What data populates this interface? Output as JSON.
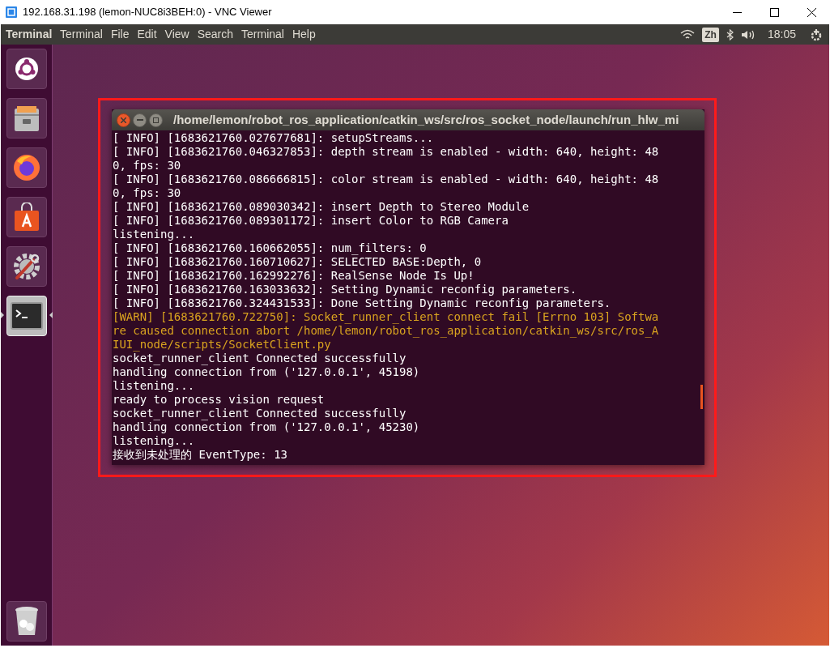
{
  "vnc_window": {
    "title": "192.168.31.198 (lemon-NUC8i3BEH:0) - VNC Viewer"
  },
  "top_panel": {
    "app_name": "Terminal",
    "menus": [
      "Terminal",
      "File",
      "Edit",
      "View",
      "Search",
      "Terminal",
      "Help"
    ],
    "keyboard_layout": "Zh",
    "clock": "18:05"
  },
  "launcher": {
    "items": [
      {
        "kind": "dash",
        "selected": false
      },
      {
        "kind": "files",
        "selected": false
      },
      {
        "kind": "firefox",
        "selected": false
      },
      {
        "kind": "software",
        "selected": false
      },
      {
        "kind": "settings",
        "selected": false
      },
      {
        "kind": "terminal",
        "selected": true
      }
    ],
    "trash": {
      "kind": "trash"
    }
  },
  "terminal": {
    "title": "/home/lemon/robot_ros_application/catkin_ws/src/ros_socket_node/launch/run_hlw_mi",
    "lines": [
      {
        "kind": "info",
        "text": "[ INFO] [1683621760.027677681]: setupStreams..."
      },
      {
        "kind": "info",
        "text": "[ INFO] [1683621760.046327853]: depth stream is enabled - width: 640, height: 48"
      },
      {
        "kind": "info",
        "text": "0, fps: 30"
      },
      {
        "kind": "info",
        "text": "[ INFO] [1683621760.086666815]: color stream is enabled - width: 640, height: 48"
      },
      {
        "kind": "info",
        "text": "0, fps: 30"
      },
      {
        "kind": "info",
        "text": "[ INFO] [1683621760.089030342]: insert Depth to Stereo Module"
      },
      {
        "kind": "info",
        "text": "[ INFO] [1683621760.089301172]: insert Color to RGB Camera"
      },
      {
        "kind": "info",
        "text": "listening..."
      },
      {
        "kind": "info",
        "text": "[ INFO] [1683621760.160662055]: num_filters: 0"
      },
      {
        "kind": "info",
        "text": "[ INFO] [1683621760.160710627]: SELECTED BASE:Depth, 0"
      },
      {
        "kind": "info",
        "text": "[ INFO] [1683621760.162992276]: RealSense Node Is Up!"
      },
      {
        "kind": "info",
        "text": "[ INFO] [1683621760.163033632]: Setting Dynamic reconfig parameters."
      },
      {
        "kind": "info",
        "text": "[ INFO] [1683621760.324431533]: Done Setting Dynamic reconfig parameters."
      },
      {
        "kind": "warn",
        "text": "[WARN] [1683621760.722750]: Socket_runner_client connect fail [Errno 103] Softwa"
      },
      {
        "kind": "warn",
        "text": "re caused connection abort /home/lemon/robot_ros_application/catkin_ws/src/ros_A"
      },
      {
        "kind": "warn",
        "text": "IUI_node/scripts/SocketClient.py"
      },
      {
        "kind": "info",
        "text": "socket_runner_client Connected successfully"
      },
      {
        "kind": "info",
        "text": "handling connection from ('127.0.0.1', 45198)"
      },
      {
        "kind": "info",
        "text": "listening..."
      },
      {
        "kind": "info",
        "text": "ready to process vision request"
      },
      {
        "kind": "info",
        "text": "socket_runner_client Connected successfully"
      },
      {
        "kind": "info",
        "text": "handling connection from ('127.0.0.1', 45230)"
      },
      {
        "kind": "info",
        "text": "listening..."
      },
      {
        "kind": "info",
        "text": "接收到未处理的 EventType: 13"
      }
    ]
  }
}
